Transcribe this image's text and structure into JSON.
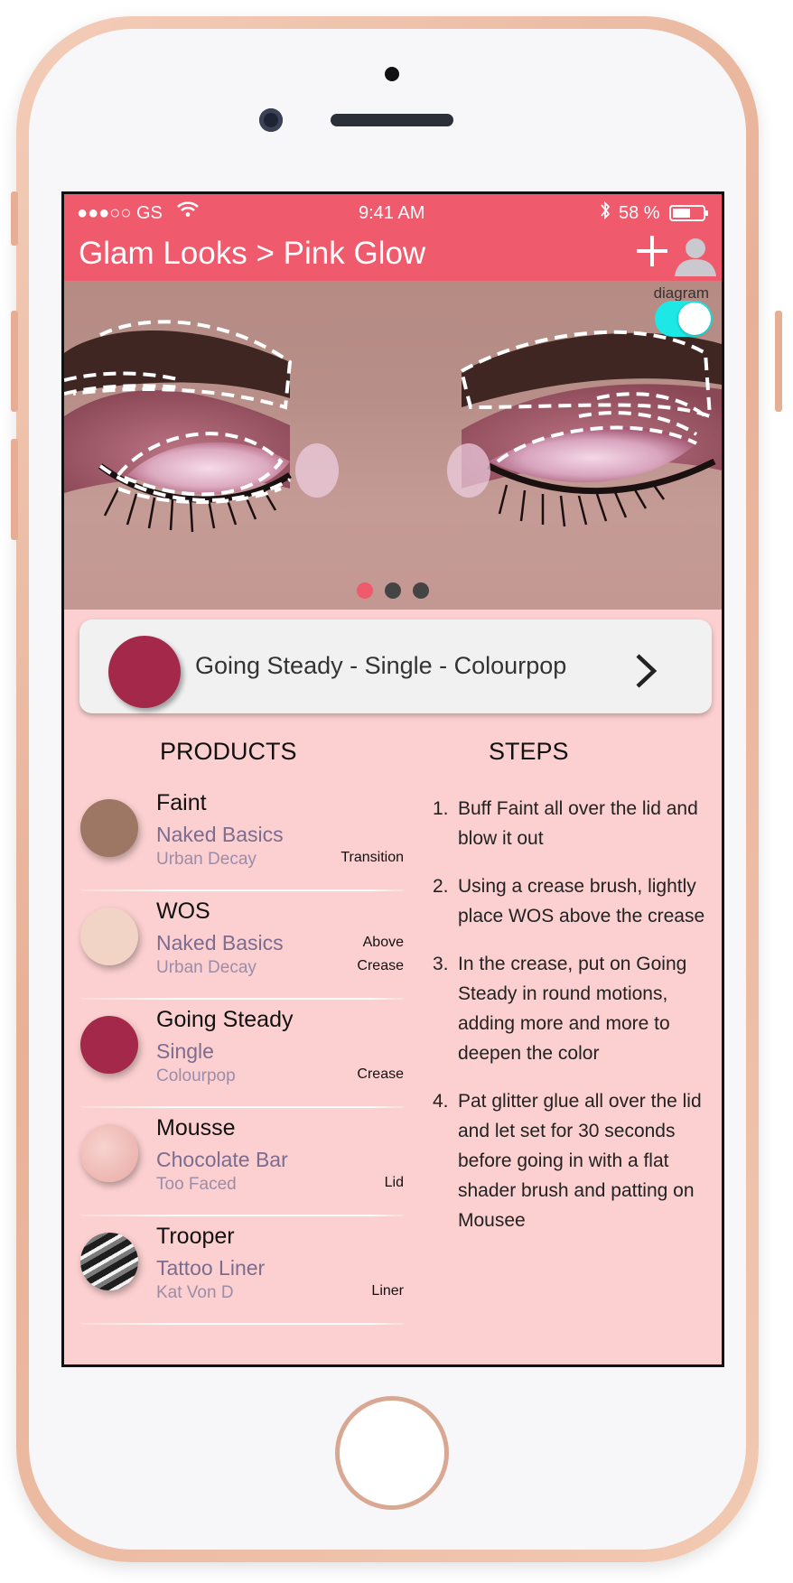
{
  "status_bar": {
    "carrier": "●●●○○ GS",
    "time": "9:41 AM",
    "battery": "58 %"
  },
  "header": {
    "title": "Glam Looks > Pink Glow",
    "add_icon": "plus-icon",
    "profile_icon": "user-icon"
  },
  "hero": {
    "toggle_label": "diagram",
    "toggle_on": true,
    "page_index": 0,
    "page_count": 3
  },
  "featured": {
    "name": "Going Steady - Single - Colourpop",
    "color": "#a3284a"
  },
  "products_heading": "PRODUCTS",
  "steps_heading": "STEPS",
  "products": [
    {
      "name": "Faint",
      "line": "Naked Basics",
      "brand": "Urban Decay",
      "placement": "Transition",
      "placement2": "",
      "color": "#9d7763"
    },
    {
      "name": "WOS",
      "line": "Naked Basics",
      "brand": "Urban Decay",
      "placement": "Crease",
      "placement2": "Above",
      "color": "#f1d4c6"
    },
    {
      "name": "Going Steady",
      "line": "Single",
      "brand": "Colourpop",
      "placement": "Crease",
      "placement2": "",
      "color": "#a3284a"
    },
    {
      "name": "Mousse",
      "line": "Chocolate Bar",
      "brand": "Too Faced",
      "placement": "Lid",
      "placement2": "",
      "color": "#f0b9b4"
    },
    {
      "name": "Trooper",
      "line": "Tattoo Liner",
      "brand": "Kat Von D",
      "placement": "Liner",
      "placement2": "",
      "color": "#2b2b2b"
    }
  ],
  "steps": [
    {
      "num": "1.",
      "text": "Buff Faint all over the lid and blow it out"
    },
    {
      "num": "2.",
      "text": "Using a crease brush, lightly place WOS above the crease"
    },
    {
      "num": "3.",
      "text": "In the crease, put on Going Steady in round motions, adding more and more to deepen the color"
    },
    {
      "num": "4.",
      "text": "Pat glitter glue all over the lid and let set for 30 seconds before going in with a flat shader brush and patting on Mousee"
    }
  ]
}
